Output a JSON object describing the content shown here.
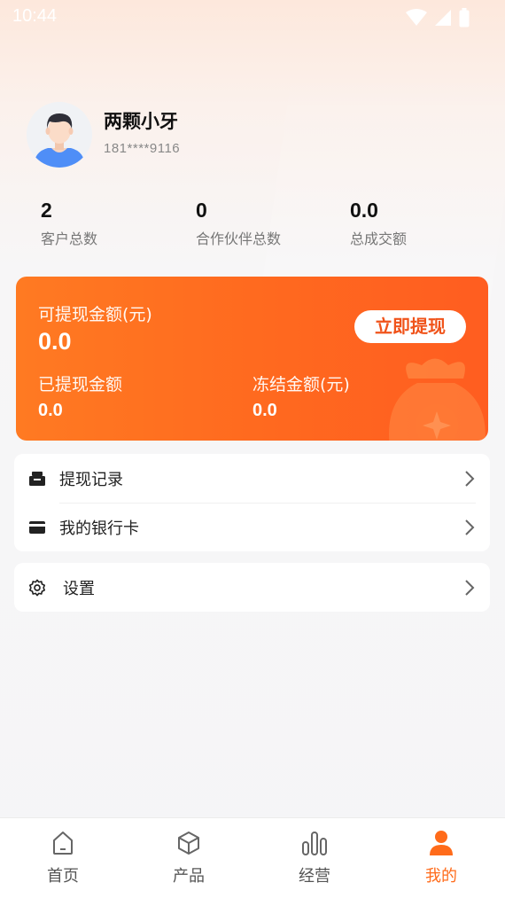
{
  "status_bar": {
    "time": "10:44"
  },
  "profile": {
    "name": "两颗小牙",
    "phone": "181****9116"
  },
  "stats": [
    {
      "value": "2",
      "label": "客户总数"
    },
    {
      "value": "0",
      "label": "合作伙伴总数"
    },
    {
      "value": "0.0",
      "label": "总成交额"
    }
  ],
  "wallet": {
    "available_label": "可提现金额(元)",
    "available_value": "0.0",
    "withdraw_button": "立即提现",
    "withdrawn_label": "已提现金额",
    "withdrawn_value": "0.0",
    "frozen_label": "冻结金额(元)",
    "frozen_value": "0.0"
  },
  "menu": {
    "withdraw_records": "提现记录",
    "bank_cards": "我的银行卡",
    "settings": "设置"
  },
  "bottom_nav": [
    {
      "label": "首页",
      "icon": "home-icon"
    },
    {
      "label": "产品",
      "icon": "box-icon"
    },
    {
      "label": "经营",
      "icon": "bar-chart-icon"
    },
    {
      "label": "我的",
      "icon": "person-icon"
    }
  ],
  "colors": {
    "accent": "#ff6b1a",
    "card_gradient_start": "#ff7a22",
    "card_gradient_end": "#ff5d20",
    "background": "#f5f5f7"
  }
}
